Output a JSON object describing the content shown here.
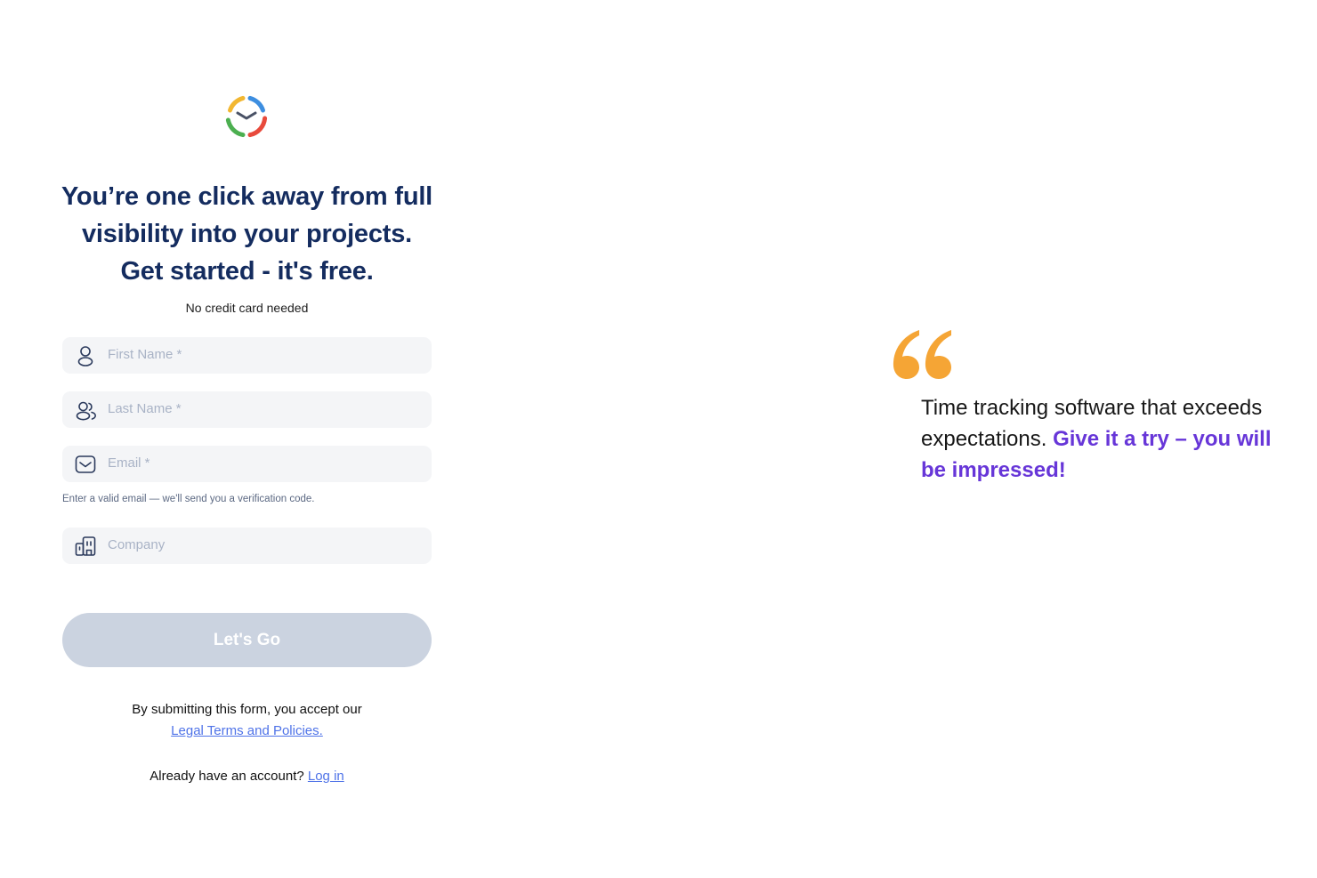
{
  "brand": {
    "logo_icon": "clock-ring-logo-icon",
    "colors": [
      "#f2b731",
      "#3d8ee0",
      "#e84a3c",
      "#4caf50",
      "#5b6479"
    ]
  },
  "heading": {
    "line1": "You’re one click away from full",
    "line2": "visibility into your projects.",
    "line3": "Get started - it's free."
  },
  "subnote": "No credit card needed",
  "form": {
    "first_name": {
      "placeholder": "First Name *",
      "icon": "user-icon"
    },
    "last_name": {
      "placeholder": "Last Name *",
      "icon": "users-icon"
    },
    "email": {
      "placeholder": "Email *",
      "icon": "mail-icon",
      "hint": "Enter a valid email — we'll send you a verification code."
    },
    "company": {
      "placeholder": "Company",
      "icon": "building-icon"
    },
    "submit_label": "Let's Go"
  },
  "legal": {
    "text": "By submitting this form, you accept our",
    "link": "Legal Terms and Policies."
  },
  "login": {
    "text": "Already have an account?",
    "link": "Log in"
  },
  "testimonial": {
    "quote_icon": "quote-mark-icon",
    "text_plain": "Time tracking software that exceeds expectations.",
    "text_accent": "Give it a try – you will be impressed!",
    "accent_color": "#6736d8",
    "quote_color": "#f5a535"
  },
  "button_disabled_color": "#cbd3e0"
}
